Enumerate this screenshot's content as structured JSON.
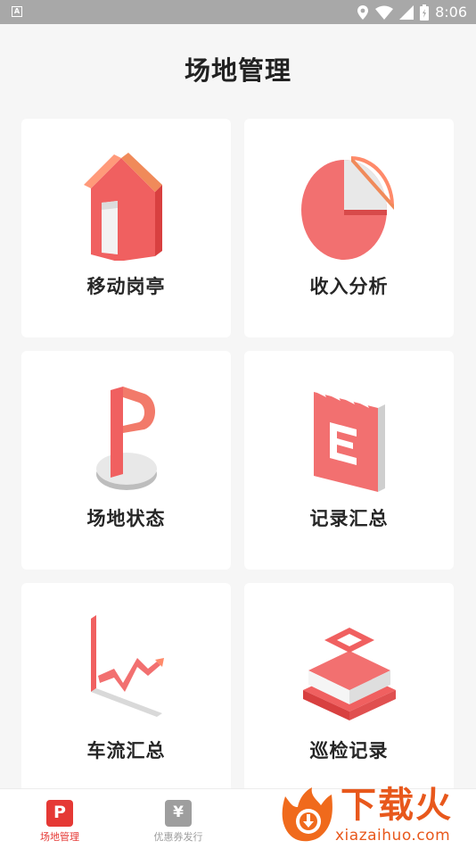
{
  "status_bar": {
    "time": "8:06",
    "notif_letter": "A"
  },
  "page": {
    "title": "场地管理"
  },
  "cards": [
    {
      "label": "移动岗亭",
      "icon": "booth-icon"
    },
    {
      "label": "收入分析",
      "icon": "pie-chart-icon"
    },
    {
      "label": "场地状态",
      "icon": "parking-sign-icon"
    },
    {
      "label": "记录汇总",
      "icon": "notepad-icon"
    },
    {
      "label": "车流汇总",
      "icon": "trend-chart-icon"
    },
    {
      "label": "巡检记录",
      "icon": "stacked-layers-icon"
    }
  ],
  "tabbar": {
    "tabs": [
      {
        "label": "场地管理",
        "icon_text": "P",
        "active": true
      },
      {
        "label": "优惠券发行",
        "icon_text": "¥",
        "active": false
      }
    ]
  },
  "watermark": {
    "name": "下载火",
    "domain": "xiazaihuo.com"
  },
  "colors": {
    "accent": "#e53935",
    "inactive": "#9e9e9e",
    "brand_red": "#f05a5a",
    "watermark": "#e8581c"
  }
}
